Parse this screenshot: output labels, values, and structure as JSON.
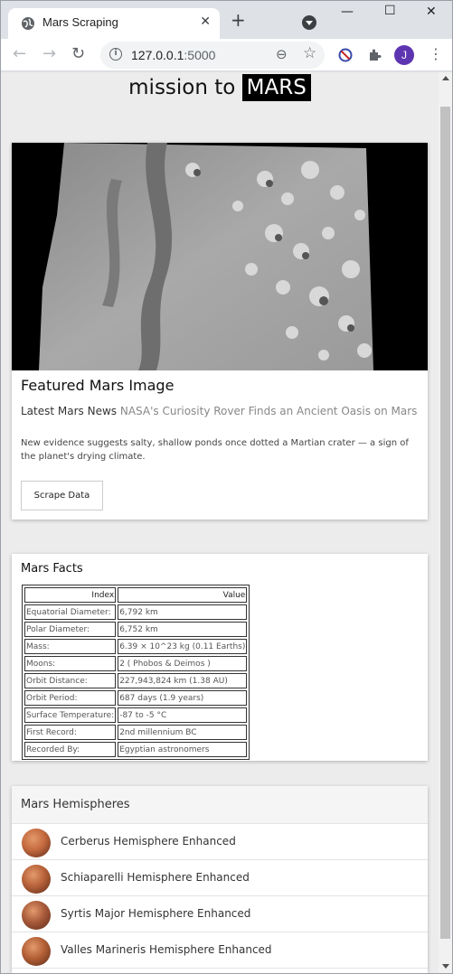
{
  "browser": {
    "tab_title": "Mars Scraping",
    "url_host": "127.0.0.1",
    "url_port": ":5000",
    "profile_initial": "J"
  },
  "page": {
    "heading_prefix": "mission to",
    "heading_highlight": "MARS",
    "featured": {
      "title": "Featured Mars Image",
      "news_label": "Latest Mars News",
      "news_title": "NASA's Curiosity Rover Finds an Ancient Oasis on Mars",
      "teaser": "New evidence suggests salty, shallow ponds once dotted a Martian crater — a sign of the planet's drying climate.",
      "button": "Scrape Data"
    },
    "facts": {
      "title": "Mars Facts",
      "columns": [
        "Index",
        "Value"
      ],
      "rows": [
        [
          "Equatorial Diameter:",
          "6,792 km"
        ],
        [
          "Polar Diameter:",
          "6,752 km"
        ],
        [
          "Mass:",
          "6.39 × 10^23 kg (0.11 Earths)"
        ],
        [
          "Moons:",
          "2 ( Phobos & Deimos )"
        ],
        [
          "Orbit Distance:",
          "227,943,824 km (1.38 AU)"
        ],
        [
          "Orbit Period:",
          "687 days (1.9 years)"
        ],
        [
          "Surface Temperature:",
          "-87 to -5 °C"
        ],
        [
          "First Record:",
          "2nd millennium BC"
        ],
        [
          "Recorded By:",
          "Egyptian astronomers"
        ]
      ]
    },
    "hemispheres": {
      "title": "Mars Hemispheres",
      "items": [
        {
          "label": "Cerberus Hemisphere Enhanced",
          "color": "#c56a3f"
        },
        {
          "label": "Schiaparelli Hemisphere Enhanced",
          "color": "#b8623a"
        },
        {
          "label": "Syrtis Major Hemisphere Enhanced",
          "color": "#a85a3a"
        },
        {
          "label": "Valles Marineris Hemisphere Enhanced",
          "color": "#b35f36"
        }
      ]
    }
  }
}
